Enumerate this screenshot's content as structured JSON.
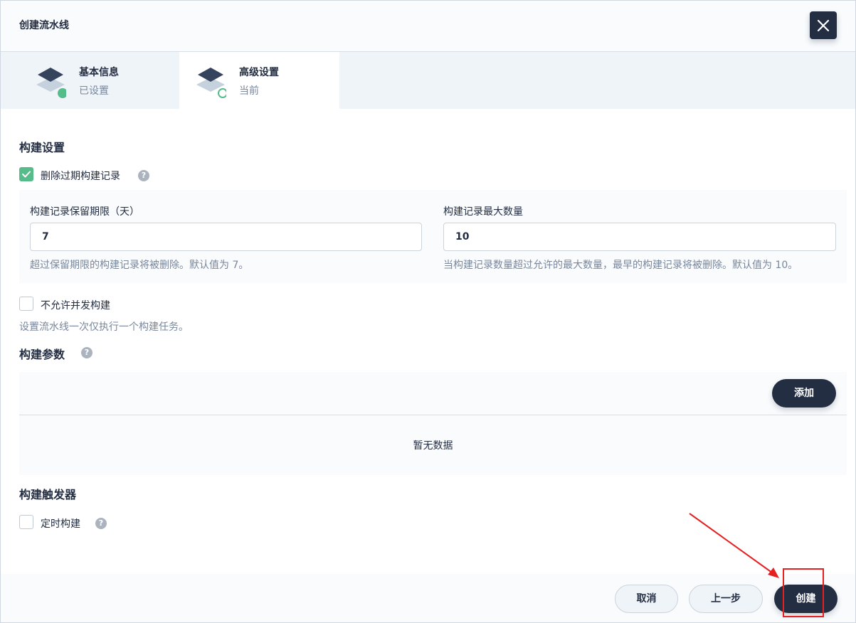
{
  "header": {
    "title": "创建流水线"
  },
  "tabs": [
    {
      "title": "基本信息",
      "status": "已设置"
    },
    {
      "title": "高级设置",
      "status": "当前"
    }
  ],
  "build_settings": {
    "title": "构建设置",
    "discard_old": {
      "label": "删除过期构建记录",
      "checked": true
    },
    "days_to_keep": {
      "label": "构建记录保留期限（天）",
      "value": "7",
      "hint": "超过保留期限的构建记录将被删除。默认值为 7。"
    },
    "num_to_keep": {
      "label": "构建记录最大数量",
      "value": "10",
      "hint": "当构建记录数量超过允许的最大数量，最早的构建记录将被删除。默认值为 10。"
    },
    "no_concurrent": {
      "label": "不允许并发构建",
      "checked": false,
      "hint": "设置流水线一次仅执行一个构建任务。"
    }
  },
  "build_params": {
    "title": "构建参数",
    "add_label": "添加",
    "empty_text": "暂无数据"
  },
  "build_triggers": {
    "title": "构建触发器",
    "timer": {
      "label": "定时构建",
      "checked": false
    }
  },
  "footer": {
    "cancel_label": "取消",
    "prev_label": "上一步",
    "create_label": "创建"
  },
  "help_glyph": "?",
  "colors": {
    "primary_dark": "#242e42",
    "success_green": "#55bc8a",
    "annotation_red": "#e52020"
  }
}
